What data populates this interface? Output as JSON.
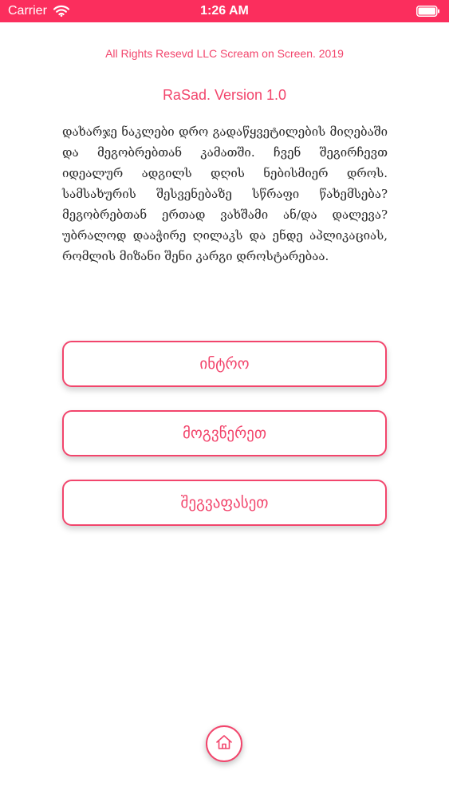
{
  "status_bar": {
    "carrier": "Carrier",
    "time": "1:26 AM",
    "background": "#fb2e5d"
  },
  "header": {
    "rights": "All Rights Resevd LLC Scream on Screen. 2019",
    "version": "RaSad. Version 1.0"
  },
  "description": "დახარჯე ნაკლები დრო გადაწყვეტილების მიღებაში და მეგობრებთან კამათში. ჩვენ შეგირჩევთ იდეალურ ადგილს დღის ნებისმიერ დროს. სამსახურის შესვენებაზე სწრაფი წახემსება? მეგობრებთან ერთად ვახშამი ან/და დალევა? უბრალოდ დააჭირე ღილაკს და ენდე აპლიკაციას, რომლის მიზანი შენი კარგი დროსტარებაა.",
  "menu": {
    "intro_label": "ინტრო",
    "contact_label": "მოგვწერეთ",
    "rate_label": "შეგვაფასეთ"
  },
  "icons": {
    "wifi": "wifi-icon",
    "battery": "battery-icon",
    "home": "home-icon"
  },
  "colors": {
    "accent": "#f2456c",
    "text": "#2a2a2a"
  }
}
